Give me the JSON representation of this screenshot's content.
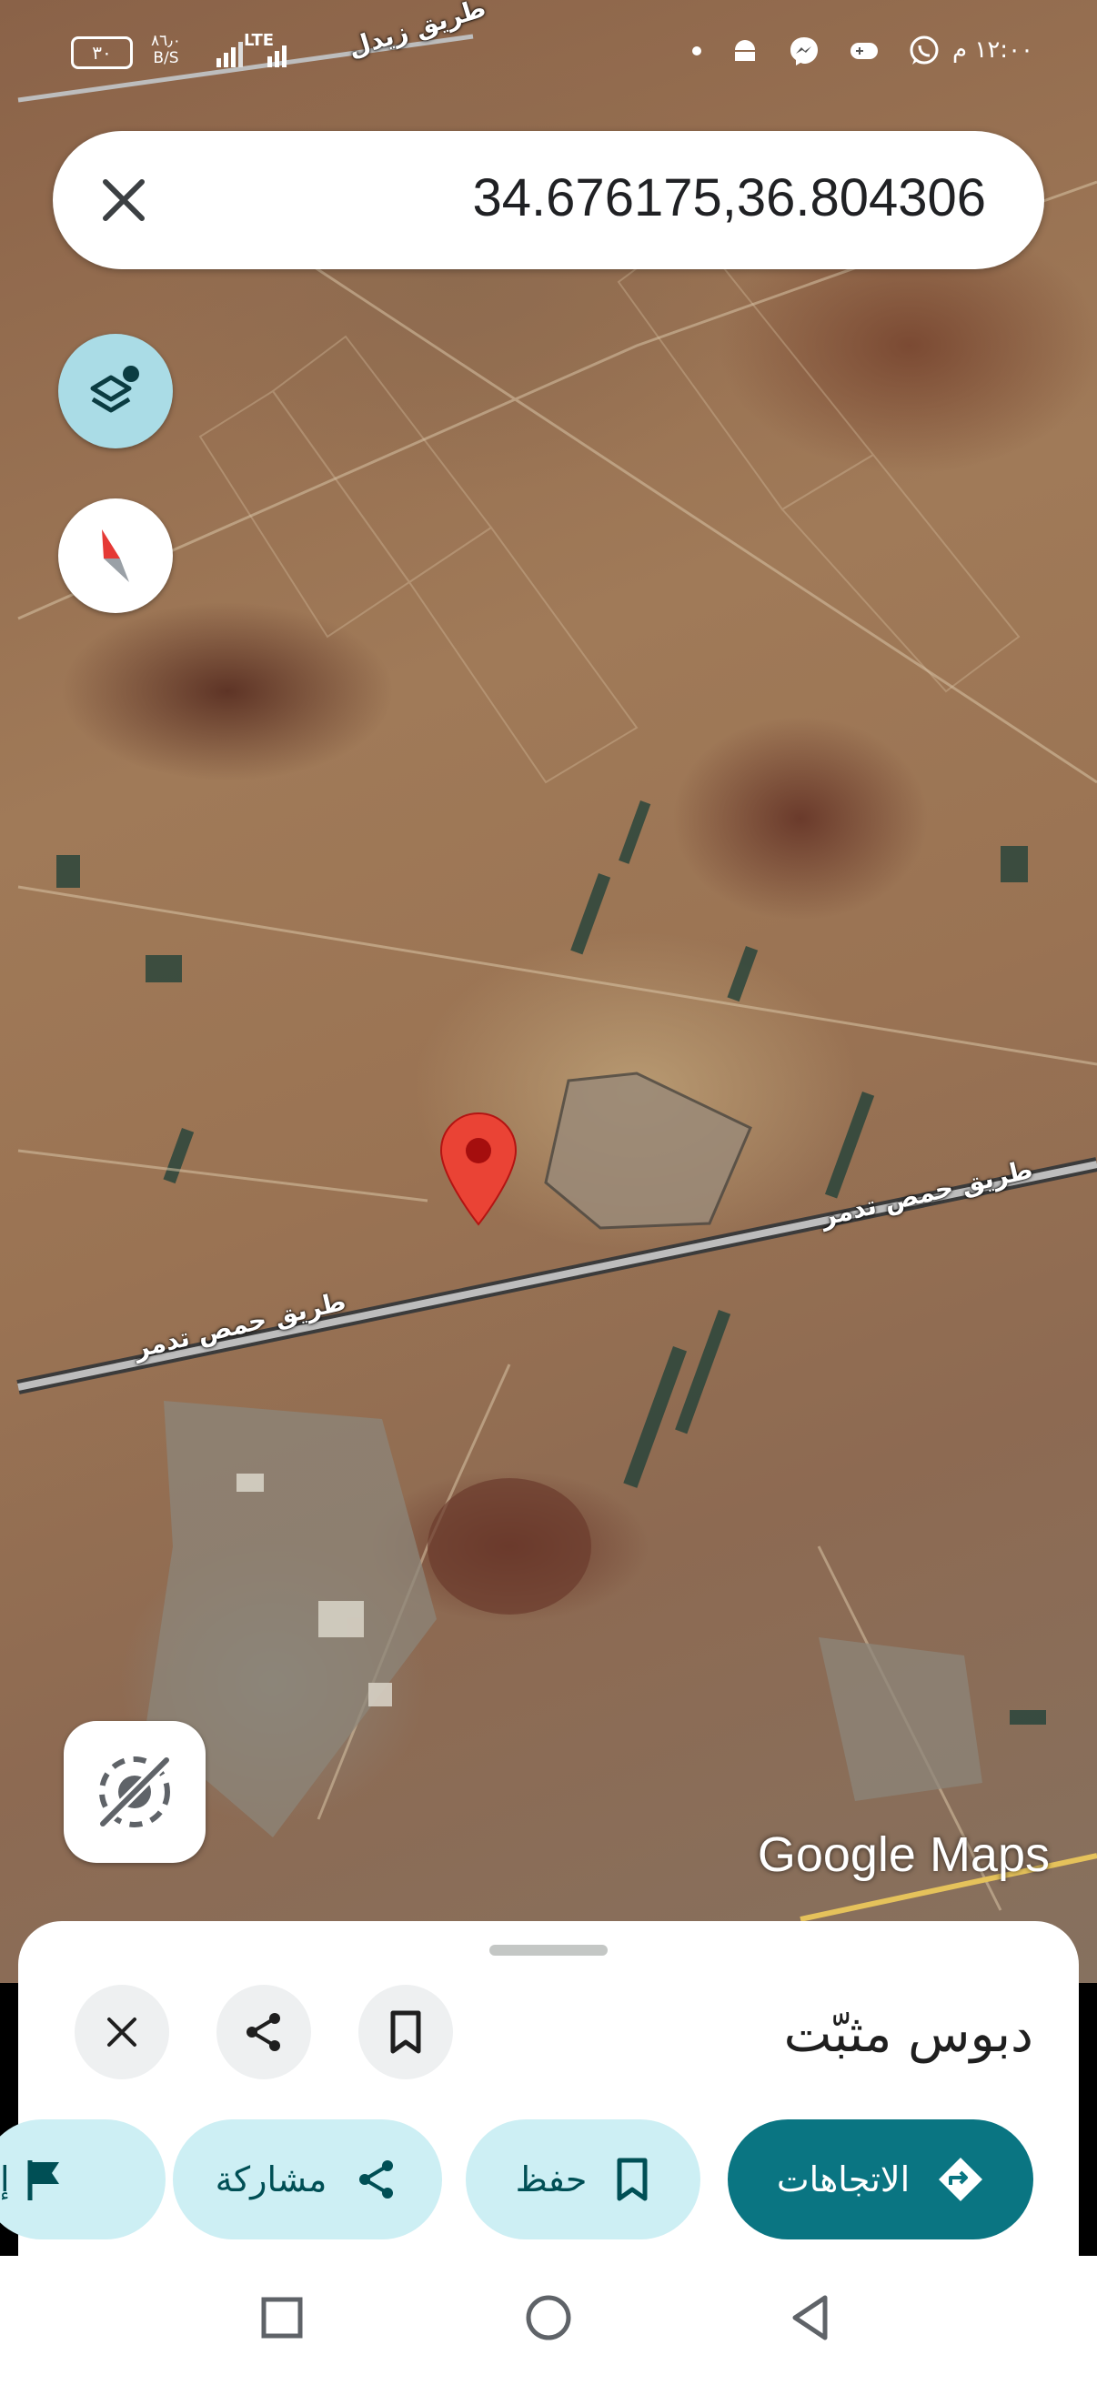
{
  "status_bar": {
    "time": "١٢:٠٠ م",
    "battery": "٣٠",
    "net_speed_value": "٨٦٫٠",
    "net_speed_unit": "B/S",
    "network": "LTE"
  },
  "search": {
    "query": "34.676175,36.804306"
  },
  "map": {
    "road_labels": {
      "top": "طريق زيدل",
      "highway_right": "طريق حمص تدمر",
      "highway_left": "طريق حمص تدمر"
    },
    "watermark": "Google Maps",
    "pin_color": "#ea4335"
  },
  "sheet": {
    "title": "دبوس مثبّت",
    "actions": {
      "directions": "الاتجاهات",
      "save": "حفظ",
      "share": "مشاركة",
      "report_partial": "إ"
    }
  },
  "colors": {
    "primary": "#0a7582",
    "chip": "#cdeff4",
    "layers_fab": "#aadce6"
  }
}
